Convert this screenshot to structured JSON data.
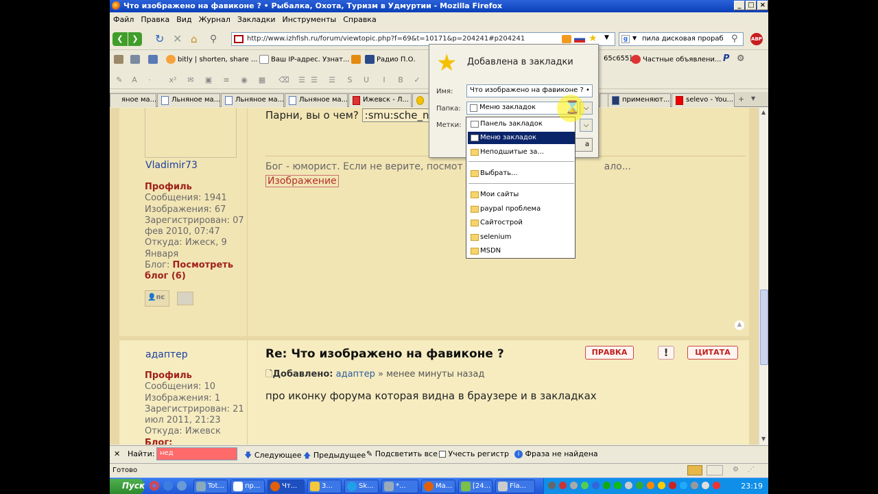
{
  "window": {
    "title": "Что изображено на фавиконе ? • Рыбалка, Охота, Туризм в Удмуртии - Mozilla Firefox"
  },
  "menu": [
    "Файл",
    "Правка",
    "Вид",
    "Журнал",
    "Закладки",
    "Инструменты",
    "Справка"
  ],
  "nav": {
    "url": "http://www.izhfish.ru/forum/viewtopic.php?f=69&t=10171&p=204241#p204241",
    "search": "пила дисковая прораб"
  },
  "bookmarks": [
    "bitly | shorten, share ...",
    "Ваш IP-адрес. Узнат...",
    "Радио П.О.",
    "65c655]",
    "Частные объявлени..."
  ],
  "tabs": [
    "яное ма...",
    "Льняное ма...",
    "Льняное ма...",
    "Льняное ма...",
    "Ижевск - Л...",
    "применяют...",
    "selevo - You..."
  ],
  "post1": {
    "partial_text": "Парни, вы о чем?",
    "code": ":smu:sche_n",
    "username": "Vladimir73",
    "profile": "Профиль",
    "stats": "Сообщения: 1941\nИзображения: 67\nЗарегистрирован: 07\nфев 2010, 07:47\nОткуда: Ижеск, 9\nЯнваря",
    "blog_label": "Блог:",
    "blog_link": "Посмотреть\nблог (6)",
    "signature": "Бог - юморист. Если не верите, посмот",
    "signature_end": "ало...",
    "image_link": "Изображение"
  },
  "post2": {
    "username": "адаптер",
    "profile": "Профиль",
    "stats": "Сообщения: 10\nИзображения: 1\nЗарегистрирован: 21\nиюл 2011, 21:23\nОткуда: Ижевск",
    "blog_cut": "Блог:",
    "title": "Re: Что изображено на фавиконе ?",
    "added_label": "Добавлено:",
    "author": "адаптер",
    "time": "» менее минуты назад",
    "body": "про иконку форума которая видна в браузере и в закладках",
    "edit_btn": "ПРАВКА",
    "report_btn": "!",
    "quote_btn": "ЦИТАТА"
  },
  "popup": {
    "header": "Добавлена в закладки",
    "name_label": "Имя:",
    "name_value": "Что изображено на фавиконе ? • Рыб",
    "folder_label": "Папка:",
    "folder_value": "Меню закладок",
    "tags_label": "Метки:",
    "btn_partial": "а",
    "folders": [
      "Панель закладок",
      "Меню закладок",
      "Неподшитые за...",
      "Выбрать...",
      "Мои сайты",
      "paypal проблема",
      "Сайтострой",
      "selenium",
      "MSDN"
    ]
  },
  "findbar": {
    "label": "Найти:",
    "value": "нед",
    "next": "Следующее",
    "prev": "Предыдущее",
    "highlight": "Подсветить все",
    "case": "Учесть регистр",
    "status": "Фраза не найдена"
  },
  "status": "Готово",
  "taskbar": {
    "start": "Пуск",
    "tasks": [
      "Tot...",
      "пр...",
      "Чт...",
      "3...",
      "Sk...",
      "*...",
      "Ма...",
      "[24...",
      "Fla..."
    ],
    "clock": "23:19"
  }
}
